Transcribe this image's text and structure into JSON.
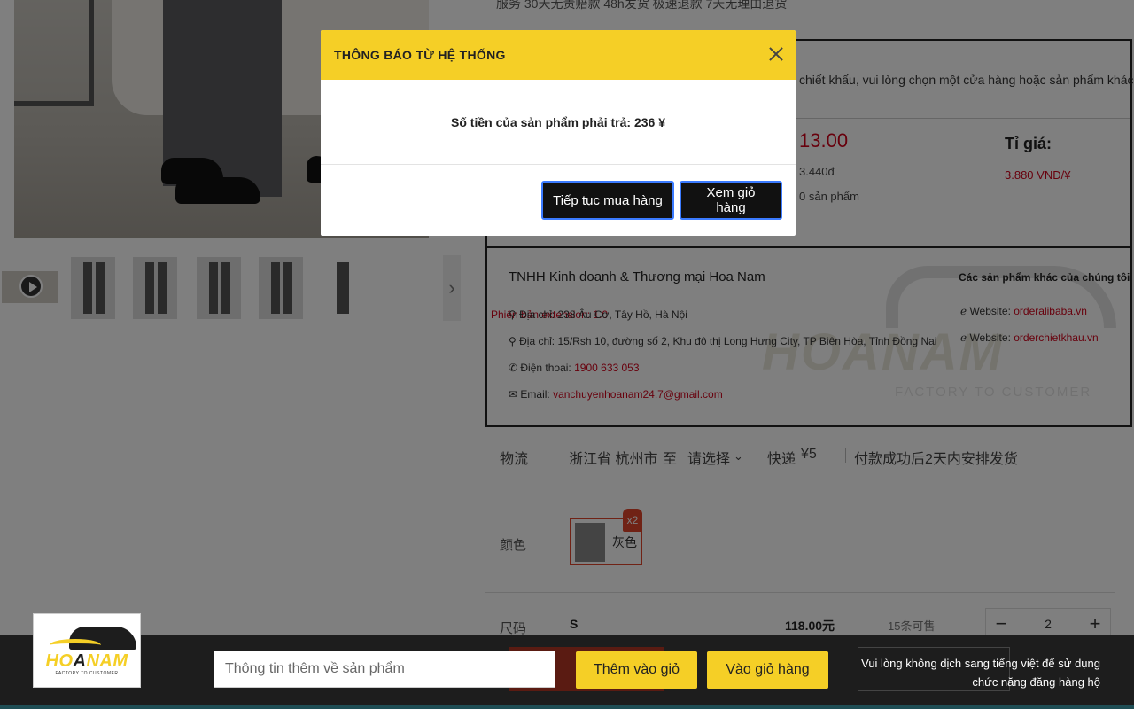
{
  "page": {
    "top_cut_text": "服务   30天无责赔款   48h发货   极速退款   7天无理由退货",
    "notice_text": "chiết khấu, vui lòng chọn một cửa hàng hoặc sản phẩm khác!",
    "price_big": "13.00",
    "price_vnd": "3.440đ",
    "price_qty": "0 sản phẩm",
    "rate_label": "Tỉ giá:",
    "rate_value": "3.880 VNĐ/¥",
    "extension_note": "Phiên bản extension: 1.0",
    "company": {
      "name": "TNHH Kinh doanh & Thương mại Hoa Nam",
      "address1_label": "Địa chỉ:",
      "address1": "238 Âu Cơ, Tây Hồ, Hà Nội",
      "address2_label": "Địa chỉ:",
      "address2": "15/Rsh 10, đường số 2, Khu đô thị Long Hưng City, TP Biên Hòa, Tỉnh Đồng Nai",
      "phone_label": "Điện thoại:",
      "phone": "1900 633 053",
      "email_label": "Email:",
      "email": "vanchuyenhoanam24.7@gmail.com",
      "other_title": "Các sản phẩm khác của chúng tôi",
      "website1_label": "Website:",
      "website1": "orderalibaba.vn",
      "website2_label": "Website:",
      "website2": "orderchietkhau.vn",
      "watermark_text": "HOANAM",
      "watermark_sub": "FACTORY TO CUSTOMER"
    },
    "shipping": {
      "label": "物流",
      "from": "浙江省 杭州市",
      "to_word": "至",
      "select": "请选择",
      "express": "快递",
      "fee": "¥5",
      "delivery": "付款成功后2天内安排发货"
    },
    "color": {
      "label": "颜色",
      "option_name": "灰色",
      "badge": "x2"
    },
    "size": {
      "label": "尺码",
      "value": "S",
      "price": "118.00元",
      "stock": "15条可售",
      "quantity": "2"
    }
  },
  "modal": {
    "title": "THÔNG BÁO TỪ HỆ THỐNG",
    "message": "Số tiền của sản phẩm phải trả: 236 ¥",
    "continue_label": "Tiếp tục mua hàng",
    "view_cart_label": "Xem giỏ hàng"
  },
  "toolbar": {
    "logo_text_a": "HO",
    "logo_text_b": "A",
    "logo_text_c": "NAM",
    "logo_sub": "FACTORY TO CUSTOMER",
    "input_placeholder": "Thông tin thêm về sản phẩm",
    "add_to_cart_label": "Thêm vào giỏ",
    "go_to_cart_label": "Vào giỏ hàng",
    "note": "Vui lòng không dịch sang tiếng việt để sử dụng chức năng đăng hàng hộ"
  },
  "colors": {
    "brand_yellow": "#f5cf26",
    "price_red": "#d0021b",
    "toolbar_bg": "#1d1d1d"
  }
}
